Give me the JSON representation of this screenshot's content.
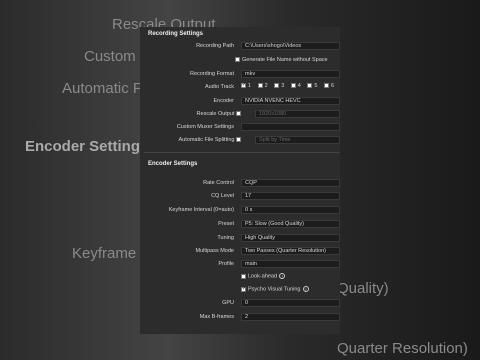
{
  "background": {
    "items": [
      "Rescale Output",
      "Custom Muxer Settings",
      "Automatic File Splitting",
      "Encoder Settings",
      "Keyframe Interval",
      "Quality)",
      "Quarter Resolution)"
    ]
  },
  "recording": {
    "title": "Recording Settings",
    "path_label": "Recording Path",
    "path_value": "C:\\Users\\shogo\\Videos",
    "no_space_label": "Generate File Name without Space",
    "format_label": "Recording Format",
    "format_value": "mkv",
    "audio_label": "Audio Track",
    "tracks": [
      "1",
      "2",
      "3",
      "4",
      "5",
      "6"
    ],
    "encoder_label": "Encoder",
    "encoder_value": "NVIDIA NVENC HEVC",
    "rescale_label": "Rescale Output",
    "rescale_value": "1920x1080",
    "muxer_label": "Custom Muxer Settings",
    "split_label": "Automatic File Splitting",
    "split_value": "Split by Time"
  },
  "encoder": {
    "title": "Encoder Settings",
    "rate_label": "Rate Control",
    "rate_value": "CQP",
    "cq_label": "CQ Level",
    "cq_value": "17",
    "keyframe_label": "Keyframe Interval (0=auto)",
    "keyframe_value": "0 s",
    "preset_label": "Preset",
    "preset_value": "P5: Slow (Good Quality)",
    "tuning_label": "Tuning",
    "tuning_value": "High Quality",
    "multipass_label": "Multipass Mode",
    "multipass_value": "Two Passes (Quarter Resolution)",
    "profile_label": "Profile",
    "profile_value": "main",
    "lookahead_label": "Look-ahead",
    "psycho_label": "Psycho Visual Tuning",
    "gpu_label": "GPU",
    "gpu_value": "0",
    "bframes_label": "Max B-frames",
    "bframes_value": "2"
  }
}
